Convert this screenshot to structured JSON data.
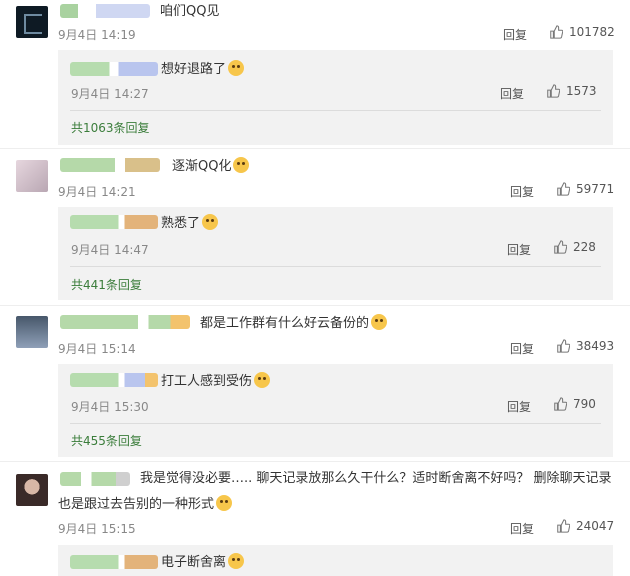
{
  "like_icon": "thumbs-up-icon",
  "colors": {
    "green_link": "#3b7d3b",
    "gray_box": "#f2f2f2"
  },
  "comments": [
    {
      "text": "咱们QQ见",
      "time": "9月4日 14:19",
      "reply_label": "回复",
      "likes": "101782",
      "sub": {
        "text": "想好退路了",
        "time": "9月4日 14:27",
        "reply_label": "回复",
        "likes": "1573"
      },
      "more": "共1063条回复"
    },
    {
      "text": "逐渐QQ化",
      "time": "9月4日 14:21",
      "reply_label": "回复",
      "likes": "59771",
      "sub": {
        "text": "熟悉了",
        "time": "9月4日 14:47",
        "reply_label": "回复",
        "likes": "228"
      },
      "more": "共441条回复"
    },
    {
      "text": "都是工作群有什么好云备份的",
      "time": "9月4日 15:14",
      "reply_label": "回复",
      "likes": "38493",
      "sub": {
        "text": "打工人感到受伤",
        "time": "9月4日 15:30",
        "reply_label": "回复",
        "likes": "790"
      },
      "more": "共455条回复"
    },
    {
      "text_line1": "我是觉得没必要….. 聊天记录放那么久干什么？适时断舍离不好吗？ 删除聊天记录",
      "text_line2": "也是跟过去告别的一种形式",
      "time": "9月4日 15:15",
      "reply_label": "回复",
      "likes": "24047",
      "sub": {
        "text": "电子断舍离"
      }
    }
  ]
}
